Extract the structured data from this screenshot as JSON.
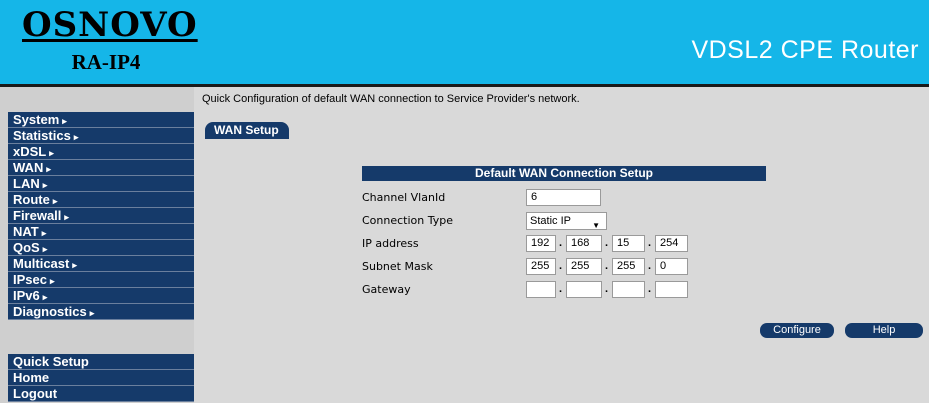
{
  "header": {
    "logo_main": "OSNOVO",
    "logo_sub": "RA-IP4",
    "product": "VDSL2 CPE Router"
  },
  "sidebar": {
    "main_menu": [
      {
        "label": "System",
        "arrow": "▸"
      },
      {
        "label": "Statistics",
        "arrow": "▸"
      },
      {
        "label": "xDSL",
        "arrow": "▸"
      },
      {
        "label": "WAN",
        "arrow": "▸"
      },
      {
        "label": "LAN",
        "arrow": "▸"
      },
      {
        "label": "Route",
        "arrow": "▸"
      },
      {
        "label": "Firewall",
        "arrow": "▸"
      },
      {
        "label": "NAT",
        "arrow": "▸"
      },
      {
        "label": "QoS",
        "arrow": "▸"
      },
      {
        "label": "Multicast",
        "arrow": "▸"
      },
      {
        "label": "IPsec",
        "arrow": "▸"
      },
      {
        "label": "IPv6",
        "arrow": "▸"
      },
      {
        "label": "Diagnostics",
        "arrow": "▸"
      }
    ],
    "quick_menu": [
      {
        "label": "Quick Setup"
      },
      {
        "label": "Home"
      },
      {
        "label": "Logout"
      }
    ]
  },
  "main": {
    "intro": "Quick Configuration of default WAN connection to Service Provider's network.",
    "tab_label": "WAN Setup",
    "form_title": "Default WAN Connection Setup",
    "fields": {
      "vlan_label": "Channel VlanId",
      "vlan_value": "6",
      "conn_type_label": "Connection Type",
      "conn_type_value": "Static IP",
      "ip_label": "IP address",
      "ip": [
        "192",
        "168",
        "15",
        "254"
      ],
      "mask_label": "Subnet Mask",
      "mask": [
        "255",
        "255",
        "255",
        "0"
      ],
      "gateway_label": "Gateway",
      "gateway": [
        "",
        "",
        "",
        ""
      ],
      "separator": "."
    },
    "buttons": {
      "configure": "Configure",
      "help": "Help"
    }
  },
  "colors": {
    "header_bg": "#15b6e8",
    "nav_bg": "#153a6a",
    "page_bg": "#d9d9d9"
  }
}
